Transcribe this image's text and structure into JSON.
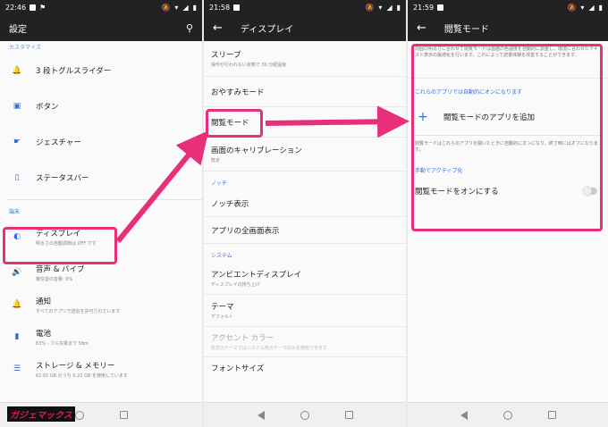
{
  "panels": [
    {
      "time": "22:46",
      "title": "設定",
      "top_cut_section": "カスタマイズ",
      "custom_items": [
        {
          "label": "3 段トグルスライダー",
          "icon": "bell-icon"
        },
        {
          "label": "ボタン",
          "icon": "button-icon"
        },
        {
          "label": "ジェスチャー",
          "icon": "gesture-icon"
        },
        {
          "label": "ステータスバー",
          "icon": "statusbar-icon"
        }
      ],
      "device_section": "端末",
      "device_items": [
        {
          "label": "ディスプレイ",
          "sub": "明るさの自動調節は OFF です",
          "icon": "display-icon"
        },
        {
          "label": "音声 & バイブ",
          "sub": "着信音の音量: 0%",
          "icon": "speaker-icon"
        },
        {
          "label": "通知",
          "sub": "すべてのアプリで送信を許可されています",
          "icon": "notification-icon"
        },
        {
          "label": "電池",
          "sub": "63% - フル充電まで 58m",
          "icon": "battery-icon"
        },
        {
          "label": "ストレージ & メモリー",
          "sub": "62.01 GB のうち 5.22 GB を使用しています",
          "icon": "storage-icon"
        }
      ],
      "logo_text": "ガジェマックス"
    },
    {
      "time": "21:58",
      "title": "ディスプレイ",
      "items_top": [
        {
          "label": "スリープ",
          "sub": "操作が行われない状態で 30 分経過後"
        },
        {
          "label": "おやすみモード",
          "sub": ""
        },
        {
          "label": "閲覧モード",
          "sub": ""
        },
        {
          "label": "画面のキャリブレーション",
          "sub": "既定"
        }
      ],
      "notch_section": "ノッチ",
      "notch_items": [
        {
          "label": "ノッチ表示"
        },
        {
          "label": "アプリの全画面表示"
        }
      ],
      "system_section": "システム",
      "system_items": [
        {
          "label": "アンビエントディスプレイ",
          "sub": "ディスプレイの持ち上げ"
        },
        {
          "label": "テーマ",
          "sub": "デフォルト"
        },
        {
          "label": "アクセント カラー",
          "sub": "既定のテーマではシステム色のテーマのみを使用できます"
        },
        {
          "label": "フォントサイズ",
          "sub": ""
        }
      ]
    },
    {
      "time": "21:59",
      "title": "閲覧モード",
      "desc1": "周囲の明るさに合わせて閲覧モードは画面の色温度を自動的に調整し、環境に合わせたテキスト表示の最適化を行います。これによって読書体験を改善することができます。",
      "auto_section": "これらのアプリでは自動的にオンになります",
      "add_label": "閲覧モードのアプリを追加",
      "desc2": "閲覧モードはこれらのアプリを開いたときに自動的にオンになり、終了時にはオフになります。",
      "manual_section": "手動でアクティブ化",
      "toggle_label": "閲覧モードをオンにする"
    }
  ],
  "colors": {
    "accent": "#2f6fe0",
    "highlight": "#e8307a",
    "appbar": "#222222"
  }
}
